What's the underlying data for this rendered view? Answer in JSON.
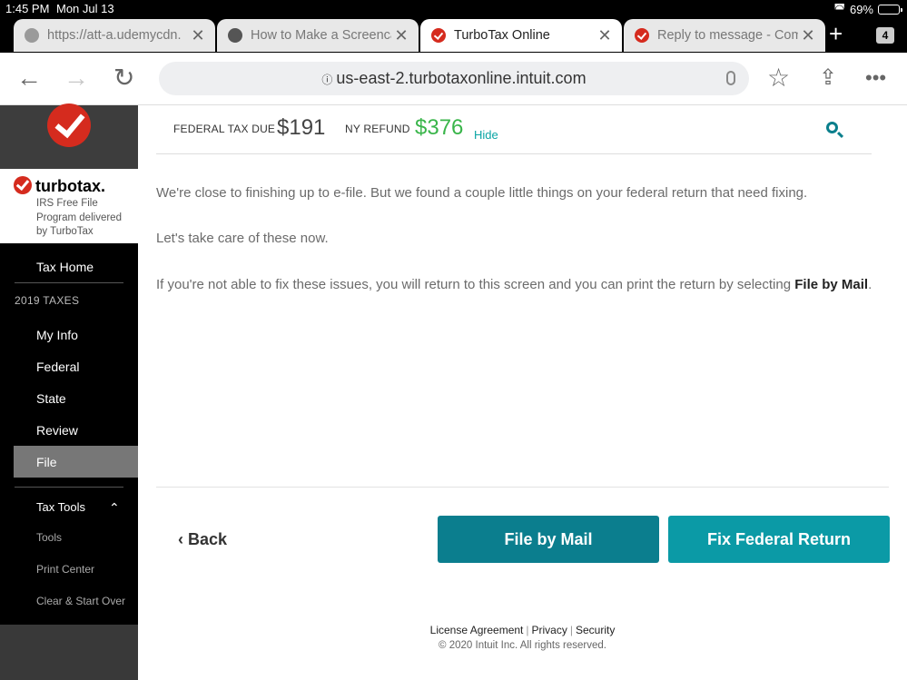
{
  "status_bar": {
    "time": "1:45 PM",
    "date": "Mon Jul 13",
    "battery": "69%"
  },
  "tabs": [
    {
      "label": "https://att-a.udemycdn.",
      "icon": "globe-icon",
      "active": false
    },
    {
      "label": "How to Make a Screencast",
      "icon": "mail-icon",
      "active": false
    },
    {
      "label": "TurboTax Online",
      "icon": "turbotax-check-icon",
      "active": true
    },
    {
      "label": "Reply to message - Comm",
      "icon": "turbotax-check-icon",
      "active": false
    }
  ],
  "tab_count": "4",
  "address_bar": {
    "url": "us-east-2.turbotaxonline.intuit.com"
  },
  "sidebar": {
    "brand_name": "turbotax.",
    "brand_sub": "IRS Free File Program delivered by TurboTax",
    "tax_home": "Tax Home",
    "section": "2019 TAXES",
    "items": [
      "My Info",
      "Federal",
      "State",
      "Review",
      "File"
    ],
    "tools_header": "Tax Tools",
    "tools": [
      "Tools",
      "Print Center",
      "Clear & Start Over"
    ]
  },
  "taxbar": {
    "federal_label": "FEDERAL TAX DUE",
    "federal_amount": "$191",
    "ny_label": "NY REFUND",
    "ny_amount": "$376",
    "hide": "Hide"
  },
  "content": {
    "p1": "We're close to finishing up to e-file. But we found a couple little things on your federal return that need fixing.",
    "p2": "Let's take care of these now.",
    "p3_prefix": "If you're not able to fix these issues, you will return to this screen and you can print the return by selecting ",
    "p3_bold": "File by Mail",
    "p3_suffix": "."
  },
  "actions": {
    "back": "Back",
    "file_by_mail": "File by Mail",
    "fix_federal": "Fix Federal Return"
  },
  "footer": {
    "license": "License Agreement",
    "privacy": "Privacy",
    "security": "Security",
    "copyright": "© 2020 Intuit Inc. All rights reserved."
  },
  "colors": {
    "accent": "#0b7e8e",
    "refund": "#39b54a",
    "brand_red": "#d52b1e"
  }
}
